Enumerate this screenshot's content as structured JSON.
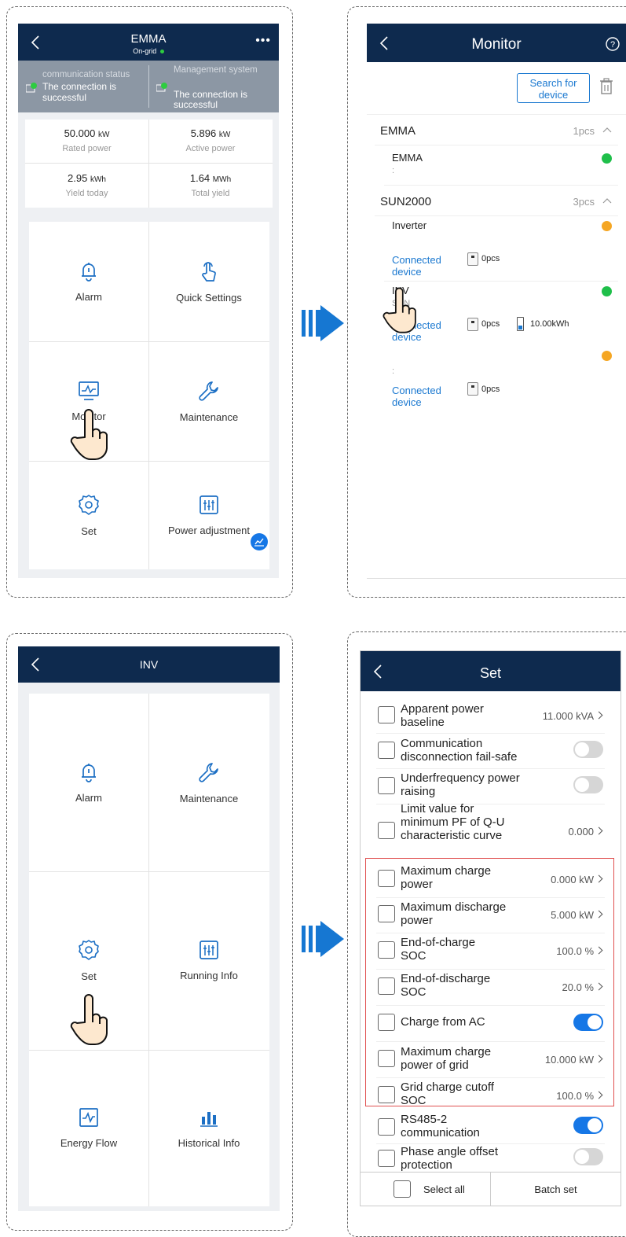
{
  "panel1": {
    "title": "EMMA",
    "subtitle": "On-grid",
    "more_icon": "more-icon",
    "comm_label": "communication status",
    "comm_value": "The connection is successful",
    "mgmt_label": "Management system",
    "mgmt_value": "The connection is successful",
    "stats": [
      {
        "value": "50.000",
        "unit": "kW",
        "label": "Rated power"
      },
      {
        "value": "5.896",
        "unit": "kW",
        "label": "Active power"
      },
      {
        "value": "2.95",
        "unit": "kWh",
        "label": "Yield today"
      },
      {
        "value": "1.64",
        "unit": "MWh",
        "label": "Total yield"
      }
    ],
    "menu": [
      "Alarm",
      "Quick Settings",
      "Monitor",
      "Maintenance",
      "Set",
      "Power adjustment"
    ]
  },
  "panel2": {
    "title": "Monitor",
    "search_button": "Search for device",
    "groups": [
      {
        "name": "EMMA",
        "count": "1pcs"
      },
      {
        "name": "SUN2000",
        "count": "3pcs"
      }
    ],
    "emma_item": "EMMA",
    "emma_sub": ":",
    "inverter1": "Inverter",
    "connected_device": "Connected device",
    "pcs1": "0pcs",
    "inv2": "INV",
    "inv2_sub": "SUN",
    "pcs2": "0pcs",
    "battery2": "10.00kWh",
    "inv3_sub": ":",
    "pcs3": "0pcs",
    "colors": {
      "green": "#1fbf4a",
      "orange": "#f5a623"
    }
  },
  "panel3": {
    "title": "INV",
    "menu": [
      "Alarm",
      "Maintenance",
      "Set",
      "Running Info",
      "Energy Flow",
      "Historical Info"
    ]
  },
  "panel4": {
    "title": "Set",
    "rows": [
      {
        "label": "Apparent power baseline",
        "value": "11.000 kVA"
      },
      {
        "label": "Communication disconnection fail-safe",
        "toggle": "off"
      },
      {
        "label": "Underfrequency power raising",
        "toggle": "off"
      },
      {
        "label": "Limit value for minimum PF of Q-U characteristic curve",
        "value": "0.000"
      },
      {
        "label": "Maximum charge power",
        "value": "0.000 kW"
      },
      {
        "label": "Maximum discharge power",
        "value": "5.000 kW"
      },
      {
        "label": "End-of-charge SOC",
        "value": "100.0 %"
      },
      {
        "label": "End-of-discharge SOC",
        "value": "20.0 %"
      },
      {
        "label": "Charge from AC",
        "toggle": "on"
      },
      {
        "label": "Maximum charge power of grid",
        "value": "10.000 kW"
      },
      {
        "label": "Grid charge cutoff SOC",
        "value": "100.0 %"
      },
      {
        "label": "RS485-2 communication",
        "toggle": "on"
      },
      {
        "label": "Phase angle offset protection",
        "toggle": "off"
      }
    ],
    "select_all": "Select all",
    "batch_set": "Batch set",
    "highlight_color": "#e05050"
  }
}
